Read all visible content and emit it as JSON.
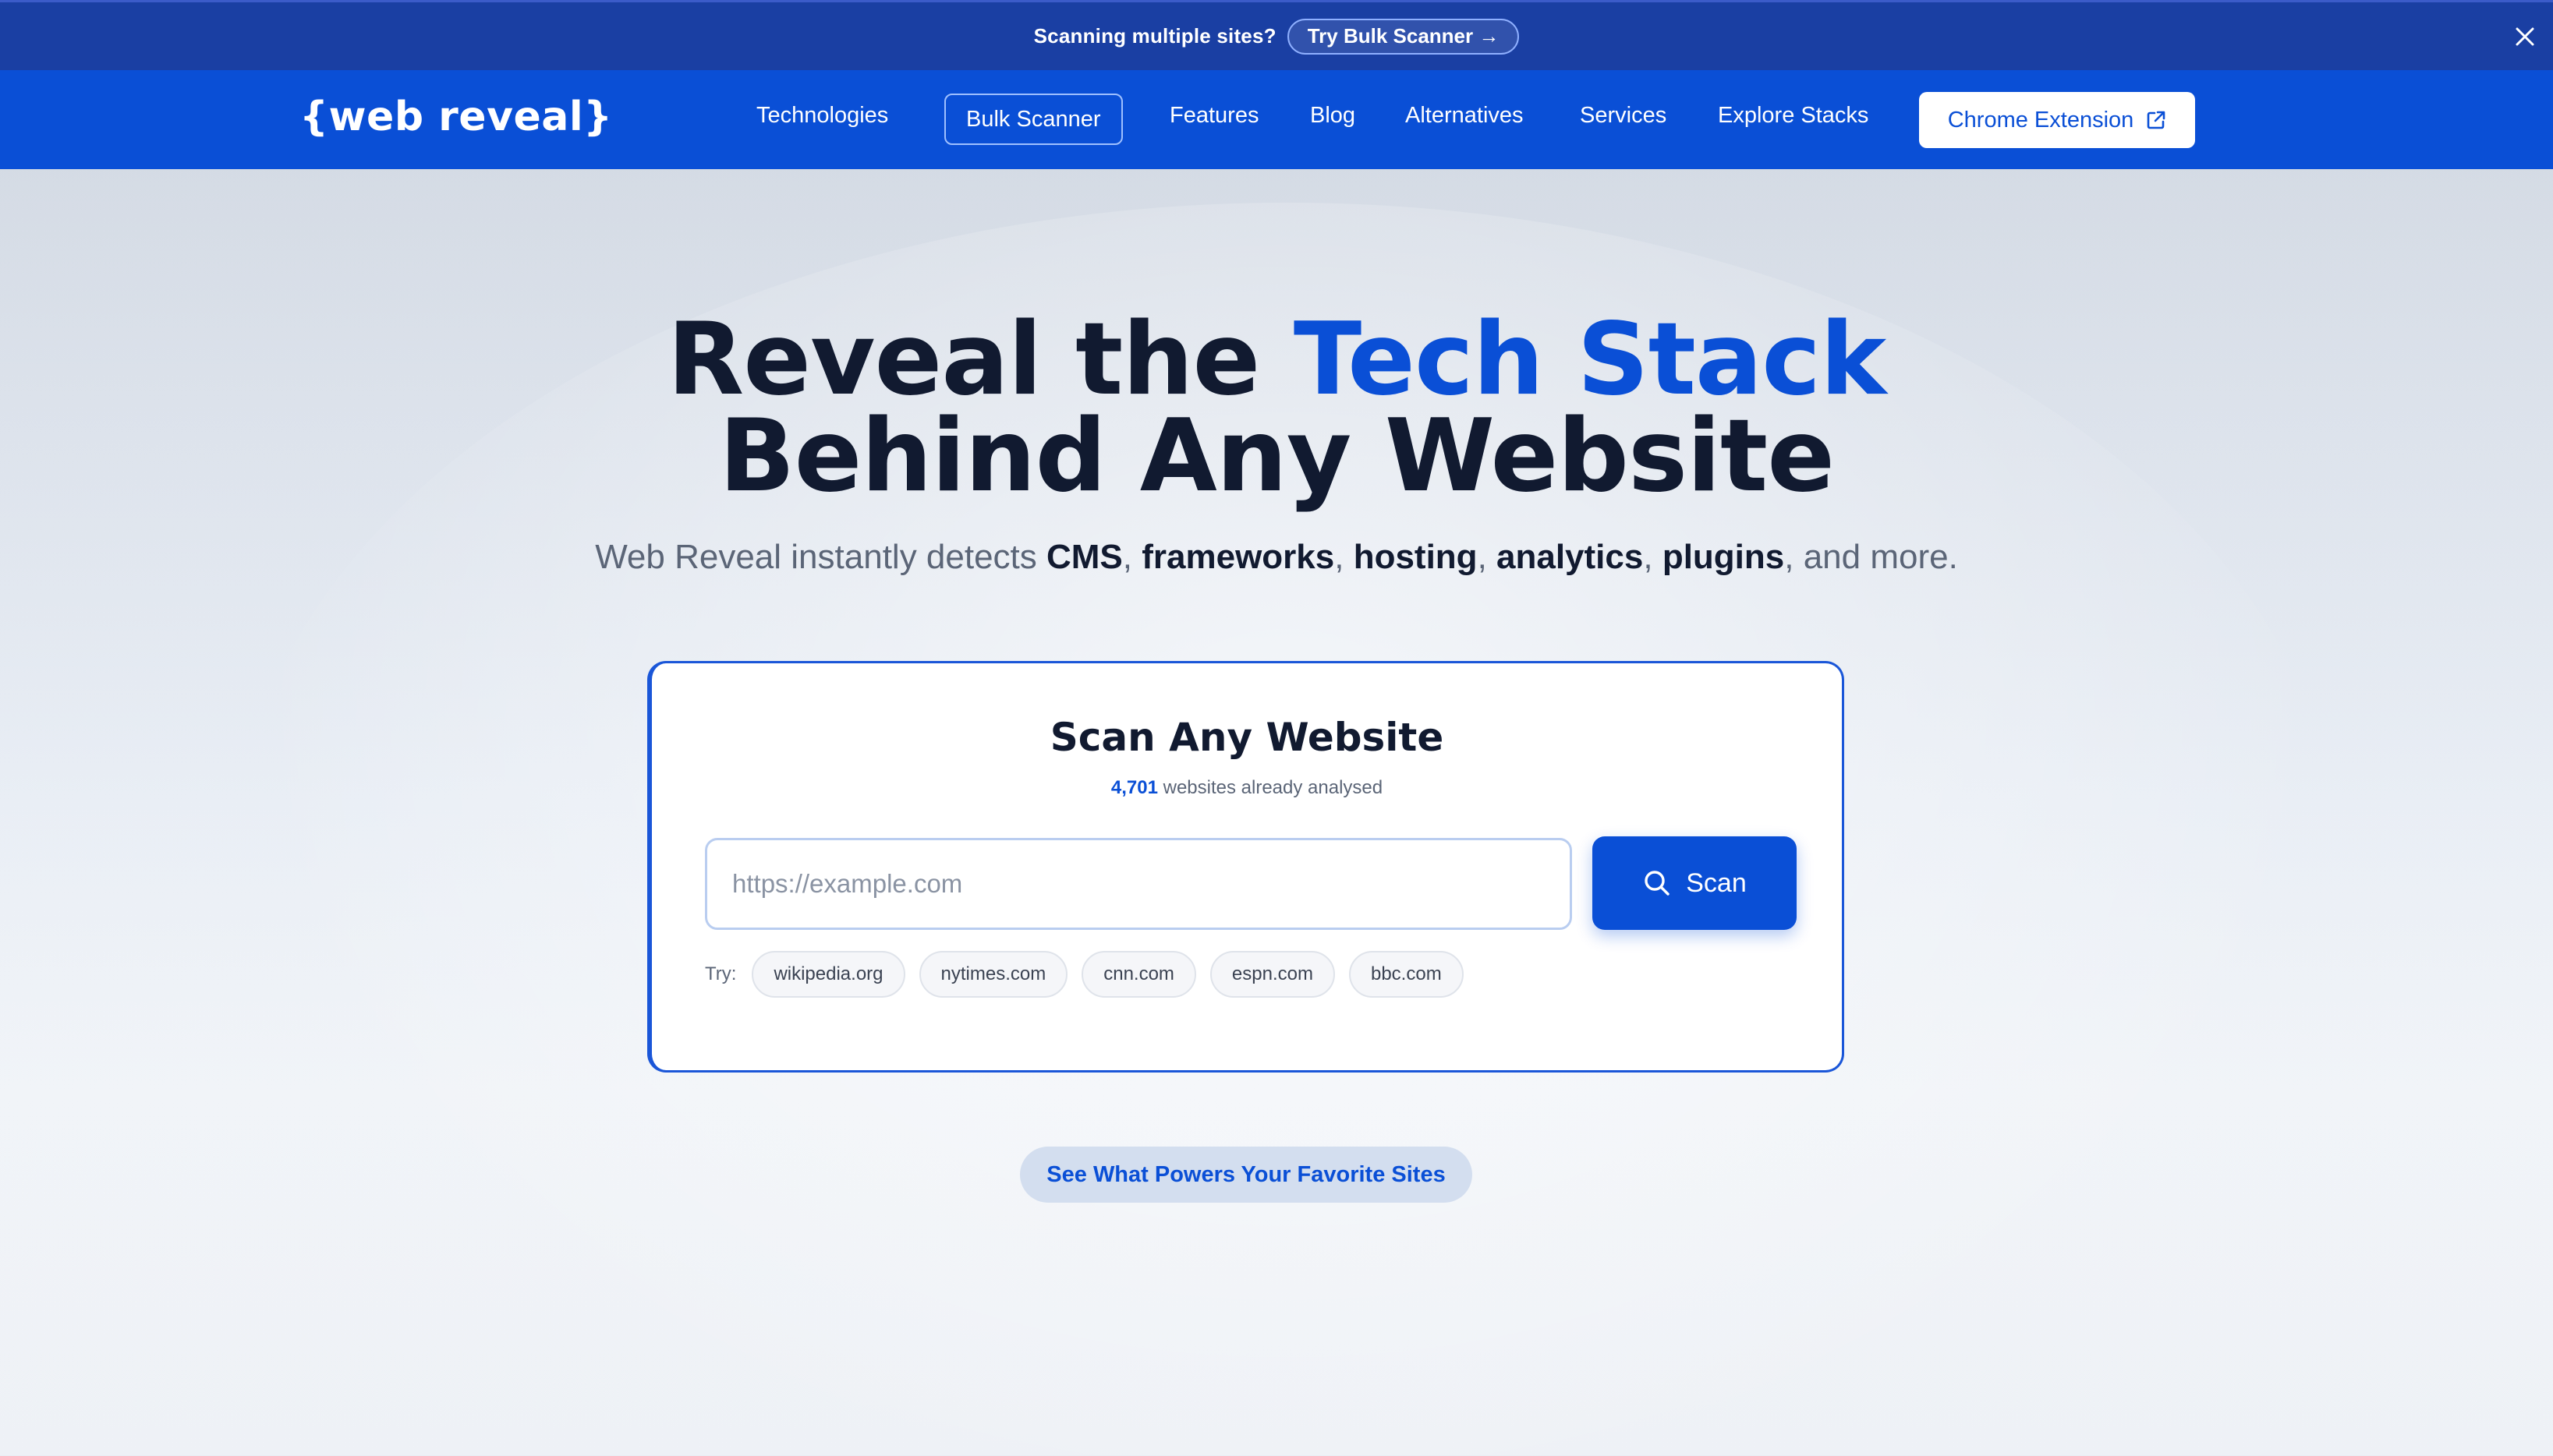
{
  "announcement": {
    "text": "Scanning multiple sites?",
    "button_label": "Try Bulk Scanner →"
  },
  "nav": {
    "logo": "{web reveal}",
    "links": [
      "Technologies",
      "Bulk Scanner",
      "Features",
      "Blog",
      "Alternatives",
      "Services",
      "Explore Stacks"
    ],
    "cta_label": "Chrome Extension"
  },
  "hero": {
    "title_part1": "Reveal the ",
    "title_accent": "Tech Stack",
    "title_line2": "Behind Any Website",
    "sub_intro": "Web Reveal instantly detects ",
    "sub_items": [
      "CMS",
      "frameworks",
      "hosting",
      "analytics",
      "plugins"
    ],
    "sub_sep": ", ",
    "sub_outro": ", and more."
  },
  "scan_card": {
    "title": "Scan Any Website",
    "count": "4,701",
    "count_suffix": " websites already analysed",
    "input_placeholder": "https://example.com",
    "input_value": "",
    "button_label": "Scan",
    "try_label": "Try:",
    "examples": [
      "wikipedia.org",
      "nytimes.com",
      "cnn.com",
      "espn.com",
      "bbc.com"
    ]
  },
  "powers_pill": "See What Powers Your Favorite Sites",
  "colors": {
    "brand_blue": "#0a4fd6",
    "announce_bg": "#1a3fa3",
    "heading": "#111a30"
  }
}
